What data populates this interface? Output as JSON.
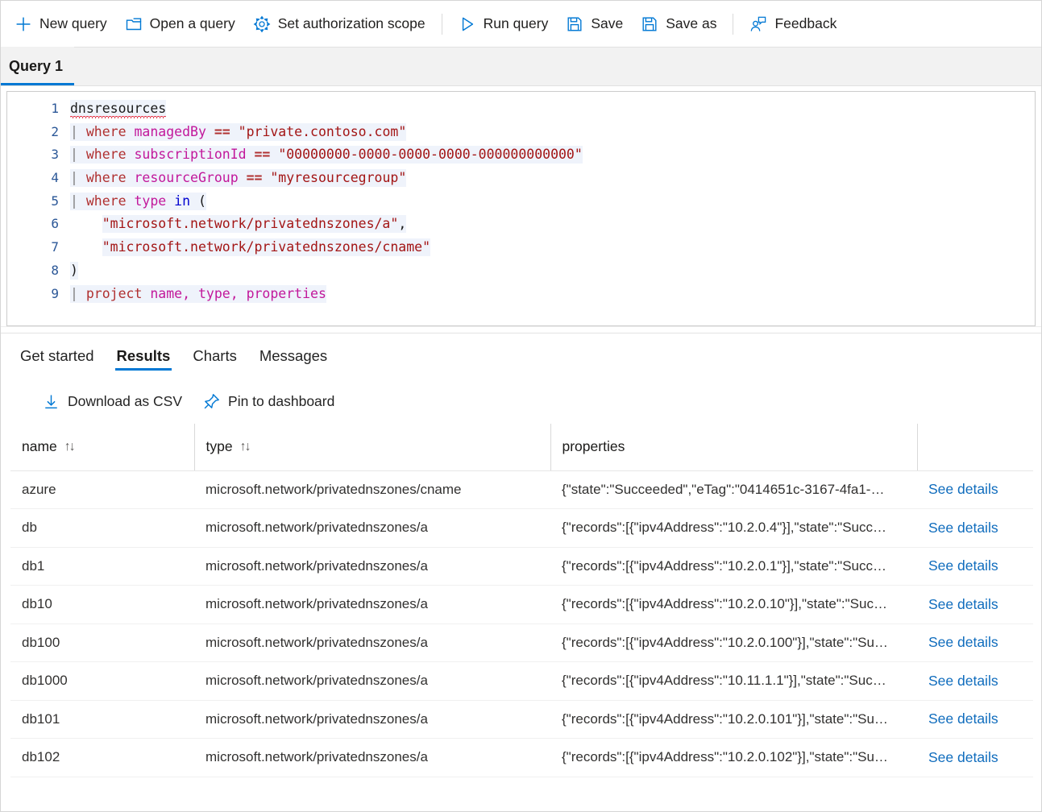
{
  "toolbar": {
    "items": [
      {
        "label": "New query",
        "icon": "plus-icon"
      },
      {
        "label": "Open a query",
        "icon": "folder-open-icon"
      },
      {
        "label": "Set authorization scope",
        "icon": "gear-icon"
      },
      {
        "label": "Run query",
        "icon": "play-icon"
      },
      {
        "label": "Save",
        "icon": "save-icon"
      },
      {
        "label": "Save as",
        "icon": "save-as-icon"
      },
      {
        "label": "Feedback",
        "icon": "person-feedback-icon"
      }
    ]
  },
  "query_tabs": [
    {
      "label": "Query 1",
      "active": true
    }
  ],
  "editor": {
    "line_numbers": [
      "1",
      "2",
      "3",
      "4",
      "5",
      "6",
      "7",
      "8",
      "9"
    ],
    "active_line": 3,
    "query_text": "dnsresources\n| where managedBy == \"private.contoso.com\"\n| where subscriptionId == \"00000000-0000-0000-0000-000000000000\"\n| where resourceGroup == \"myresourcegroup\"\n| where type in (\n    \"microsoft.network/privatednszones/a\",\n    \"microsoft.network/privatednszones/cname\"\n)\n| project name, type, properties",
    "lines": [
      {
        "n": "1",
        "table": "dnsresources",
        "spellcheck_error": true
      },
      {
        "n": "2",
        "keyword": "where",
        "field": "managedBy",
        "op": "==",
        "string": "\"private.contoso.com\""
      },
      {
        "n": "3",
        "keyword": "where",
        "field": "subscriptionId",
        "op": "==",
        "string": "\"00000000-0000-0000-0000-000000000000\""
      },
      {
        "n": "4",
        "keyword": "where",
        "field": "resourceGroup",
        "op": "==",
        "string": "\"myresourcegroup\""
      },
      {
        "n": "5",
        "keyword": "where",
        "field": "type",
        "operator_in": "in",
        "paren": "("
      },
      {
        "n": "6",
        "string": "\"microsoft.network/privatednszones/a\"",
        "comma": ","
      },
      {
        "n": "7",
        "string": "\"microsoft.network/privatednszones/cname\""
      },
      {
        "n": "8",
        "paren": ")"
      },
      {
        "n": "9",
        "keyword": "project",
        "fields": "name, type, properties"
      }
    ]
  },
  "results": {
    "tabs": [
      {
        "label": "Get started",
        "active": false
      },
      {
        "label": "Results",
        "active": true
      },
      {
        "label": "Charts",
        "active": false
      },
      {
        "label": "Messages",
        "active": false
      }
    ],
    "actions": [
      {
        "label": "Download as CSV",
        "icon": "download-icon"
      },
      {
        "label": "Pin to dashboard",
        "icon": "pin-icon"
      }
    ],
    "columns": [
      {
        "key": "name",
        "label": "name",
        "sortable": true,
        "sort_icon": "↑↓"
      },
      {
        "key": "type",
        "label": "type",
        "sortable": true,
        "sort_icon": "↑↓"
      },
      {
        "key": "properties",
        "label": "properties",
        "sortable": false
      },
      {
        "key": "actions",
        "label": "",
        "sortable": false
      }
    ],
    "link_label": "See details",
    "rows": [
      {
        "name": "azure",
        "type": "microsoft.network/privatednszones/cname",
        "properties": "{\"state\":\"Succeeded\",\"eTag\":\"0414651c-3167-4fa1-…",
        "action": "See details"
      },
      {
        "name": "db",
        "type": "microsoft.network/privatednszones/a",
        "properties": "{\"records\":[{\"ipv4Address\":\"10.2.0.4\"}],\"state\":\"Succ…",
        "action": "See details"
      },
      {
        "name": "db1",
        "type": "microsoft.network/privatednszones/a",
        "properties": "{\"records\":[{\"ipv4Address\":\"10.2.0.1\"}],\"state\":\"Succ…",
        "action": "See details"
      },
      {
        "name": "db10",
        "type": "microsoft.network/privatednszones/a",
        "properties": "{\"records\":[{\"ipv4Address\":\"10.2.0.10\"}],\"state\":\"Suc…",
        "action": "See details"
      },
      {
        "name": "db100",
        "type": "microsoft.network/privatednszones/a",
        "properties": "{\"records\":[{\"ipv4Address\":\"10.2.0.100\"}],\"state\":\"Su…",
        "action": "See details"
      },
      {
        "name": "db1000",
        "type": "microsoft.network/privatednszones/a",
        "properties": "{\"records\":[{\"ipv4Address\":\"10.11.1.1\"}],\"state\":\"Suc…",
        "action": "See details"
      },
      {
        "name": "db101",
        "type": "microsoft.network/privatednszones/a",
        "properties": "{\"records\":[{\"ipv4Address\":\"10.2.0.101\"}],\"state\":\"Su…",
        "action": "See details"
      },
      {
        "name": "db102",
        "type": "microsoft.network/privatednszones/a",
        "properties": "{\"records\":[{\"ipv4Address\":\"10.2.0.102\"}],\"state\":\"Su…",
        "action": "See details"
      }
    ]
  },
  "colors": {
    "accent": "#0078d4",
    "link": "#0f6cbd",
    "tab_strip_bg": "#f2f2f2",
    "keyword": "#b03030",
    "field": "#c2189b",
    "string": "#a31515",
    "operator_in": "#0000d0",
    "line_number": "#2b5797",
    "error_squiggle": "#e81123"
  }
}
